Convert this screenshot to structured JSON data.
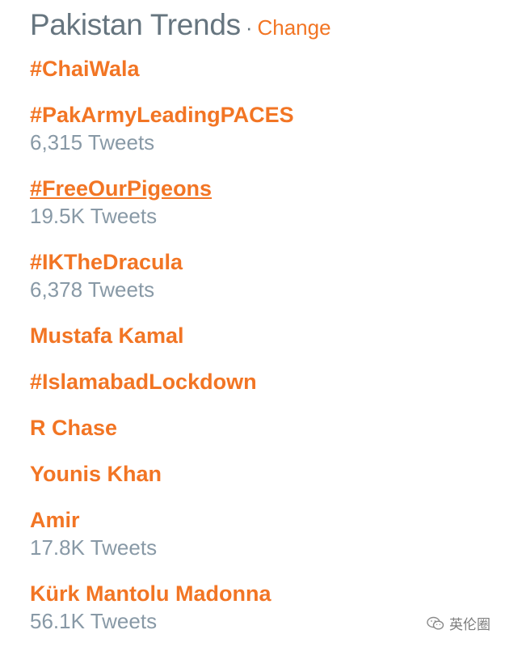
{
  "header": {
    "title": "Pakistan Trends",
    "separator": "·",
    "change_label": "Change"
  },
  "trends": [
    {
      "name": "#ChaiWala",
      "count": ""
    },
    {
      "name": "#PakArmyLeadingPACES",
      "count": "6,315 Tweets"
    },
    {
      "name": "#FreeOurPigeons",
      "count": "19.5K Tweets",
      "hovered": true
    },
    {
      "name": "#IKTheDracula",
      "count": "6,378 Tweets"
    },
    {
      "name": "Mustafa Kamal",
      "count": ""
    },
    {
      "name": "#IslamabadLockdown",
      "count": ""
    },
    {
      "name": "R Chase",
      "count": ""
    },
    {
      "name": "Younis Khan",
      "count": ""
    },
    {
      "name": "Amir",
      "count": "17.8K Tweets"
    },
    {
      "name": "Kürk Mantolu Madonna",
      "count": "56.1K Tweets"
    }
  ],
  "watermark": {
    "text": "英伦圈",
    "icon": "wechat-icon"
  },
  "colors": {
    "accent": "#f27524",
    "muted": "#8899a6",
    "title": "#66757f"
  }
}
